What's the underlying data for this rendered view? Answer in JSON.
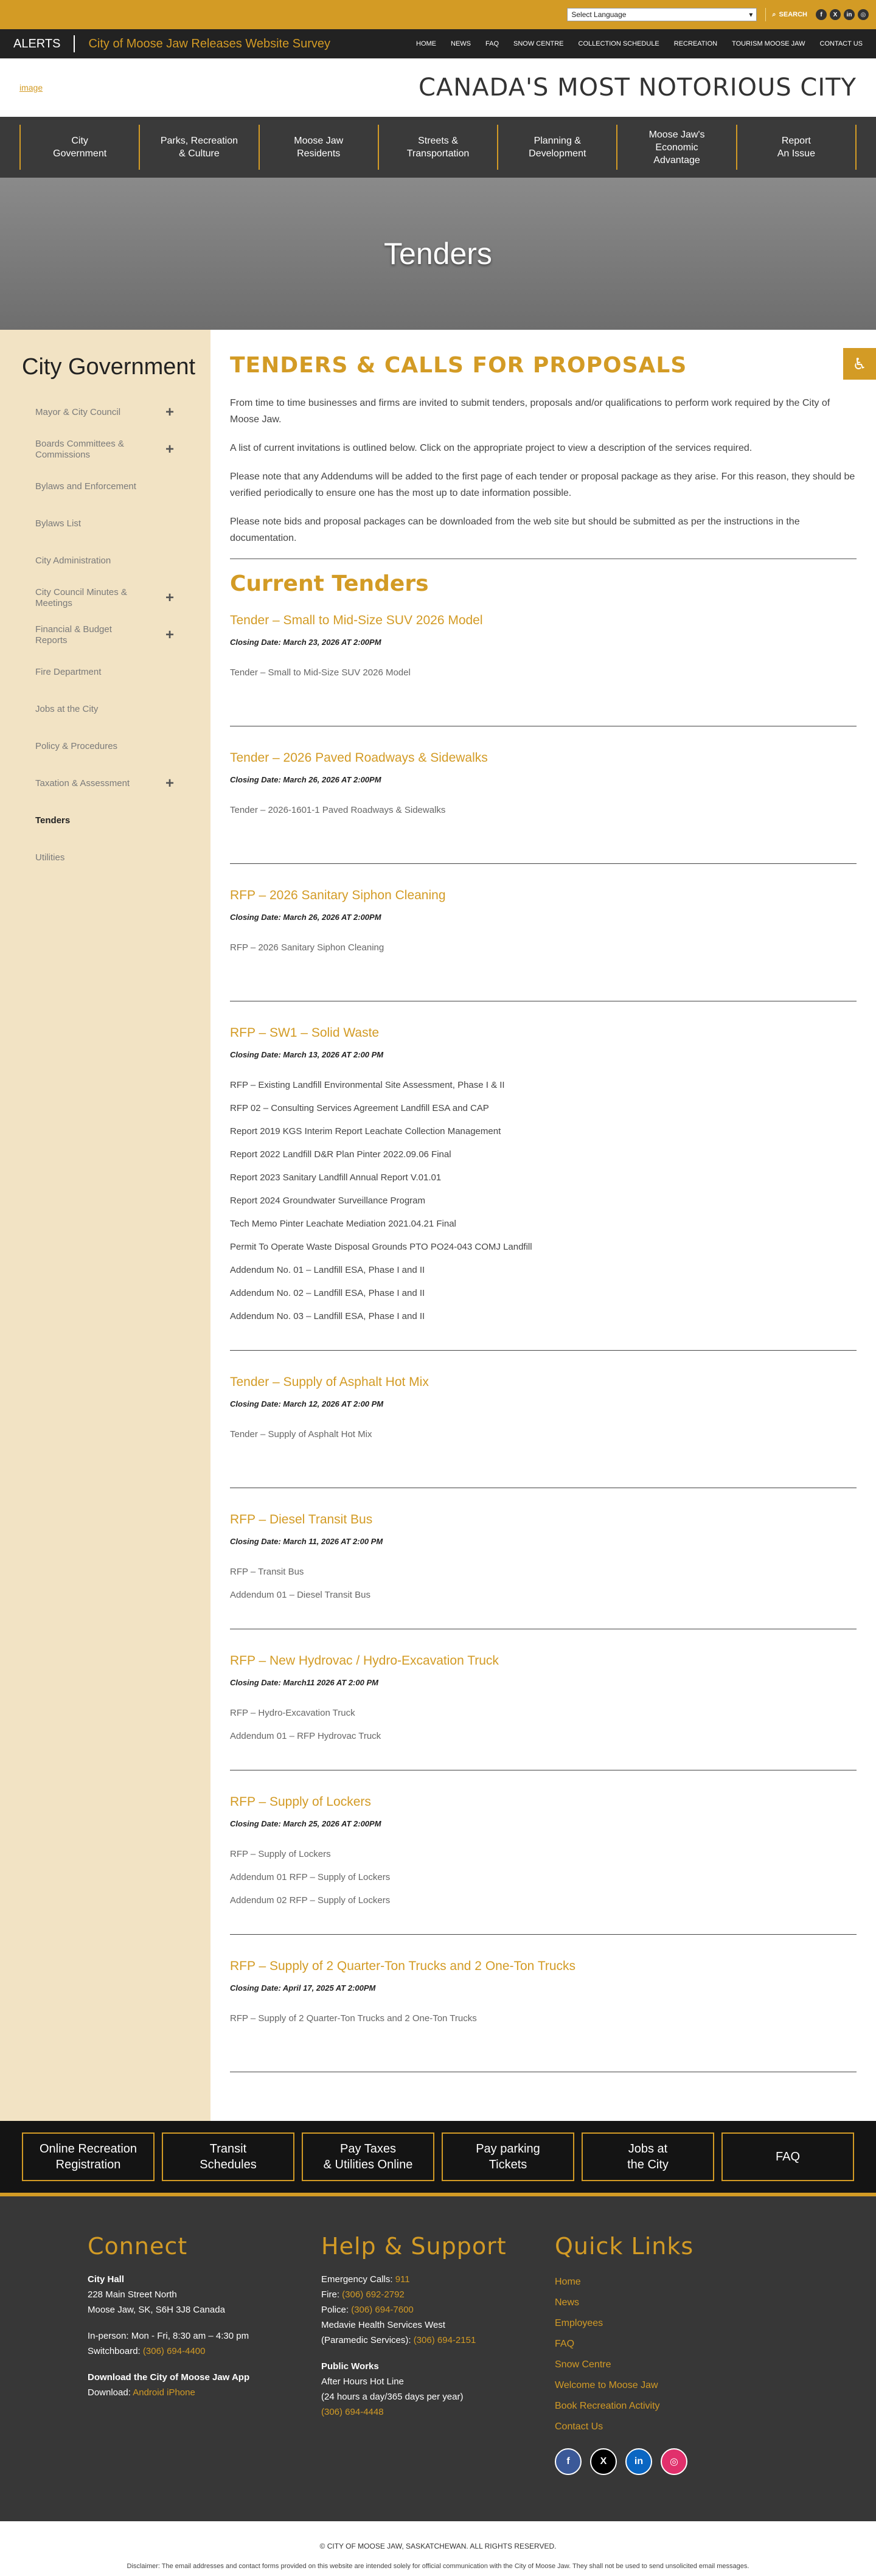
{
  "topbar": {
    "language_select": "Select Language",
    "search_label": "SEARCH",
    "social": [
      "facebook-icon",
      "x-icon",
      "linkedin-icon",
      "instagram-icon"
    ]
  },
  "alerts": {
    "label": "ALERTS",
    "message": "City of Moose Jaw Releases Website Survey"
  },
  "top_nav": [
    "HOME",
    "NEWS",
    "FAQ",
    "SNOW CENTRE",
    "COLLECTION SCHEDULE",
    "RECREATION",
    "TOURISM MOOSE JAW",
    "CONTACT US"
  ],
  "header": {
    "logo_alt": "image",
    "tagline": "CANADA'S MOST NOTORIOUS CITY"
  },
  "main_nav": [
    "City\nGovernment",
    "Parks, Recreation\n& Culture",
    "Moose Jaw\nResidents",
    "Streets &\nTransportation",
    "Planning &\nDevelopment",
    "Moose Jaw's\nEconomic\nAdvantage",
    "Report\nAn Issue"
  ],
  "banner": {
    "title": "Tenders"
  },
  "sidebar": {
    "title": "City Government",
    "items": [
      {
        "label": "Mayor & City Council",
        "expand": "+"
      },
      {
        "label": "Boards Committees & Commissions",
        "expand": "+"
      },
      {
        "label": "Bylaws and Enforcement",
        "expand": ""
      },
      {
        "label": "Bylaws List",
        "expand": ""
      },
      {
        "label": "City Administration",
        "expand": ""
      },
      {
        "label": "City Council Minutes & Meetings",
        "expand": "+"
      },
      {
        "label": "Financial & Budget Reports",
        "expand": "+"
      },
      {
        "label": "Fire Department",
        "expand": ""
      },
      {
        "label": "Jobs at the City",
        "expand": ""
      },
      {
        "label": "Policy & Procedures",
        "expand": ""
      },
      {
        "label": "Taxation & Assessment",
        "expand": "+"
      },
      {
        "label": "Tenders",
        "expand": ""
      },
      {
        "label": "Utilities",
        "expand": ""
      }
    ]
  },
  "main": {
    "heading": "TENDERS & CALLS FOR PROPOSALS",
    "intro": [
      "From time to time businesses and firms are invited to submit tenders, proposals and/or qualifications to perform work required by the City of Moose Jaw.",
      "A list of current invitations is outlined below. Click on the appropriate project to view a description of the services required.",
      "Please note that any Addendums will be added to the first page of each tender or proposal package as they arise. For this reason, they should be verified periodically to ensure one has the most up to date information possible.",
      "Please note bids and proposal packages can be downloaded from the web site but should be submitted as per the instructions in the documentation."
    ],
    "current_heading": "Current Tenders",
    "tenders": [
      {
        "title": "Tender – Small to Mid-Size SUV 2026 Model",
        "closing": "Closing Date: March 23, 2026 AT 2:00PM",
        "docs": [
          "Tender – Small to Mid-Size SUV 2026 Model"
        ]
      },
      {
        "title": "Tender – 2026 Paved Roadways & Sidewalks",
        "closing": "Closing Date: March 26, 2026 AT 2:00PM",
        "docs": [
          "Tender – 2026-1601-1 Paved Roadways & Sidewalks"
        ]
      },
      {
        "title": "RFP – 2026 Sanitary Siphon Cleaning",
        "closing": "Closing Date: March 26, 2026 AT 2:00PM",
        "docs": [
          "RFP – 2026 Sanitary Siphon Cleaning"
        ]
      },
      {
        "title": "RFP – SW1 – Solid Waste",
        "closing": "Closing Date: March 13, 2026 AT 2:00 PM",
        "docs": [
          "RFP – Existing Landfill Environmental Site Assessment, Phase I & II",
          "RFP 02 – Consulting Services Agreement Landfill ESA and CAP",
          "Report 2019 KGS Interim Report Leachate Collection Management",
          "Report 2022 Landfill D&R Plan Pinter 2022.09.06 Final",
          "Report 2023 Sanitary Landfill Annual Report V.01.01",
          "Report 2024 Groundwater Surveillance Program",
          "Tech Memo Pinter Leachate Mediation 2021.04.21 Final",
          "Permit To Operate Waste Disposal Grounds PTO PO24-043 COMJ Landfill",
          "Addendum No. 01 – Landfill ESA, Phase I and II",
          "Addendum No. 02 – Landfill ESA, Phase I and II",
          "Addendum No. 03 – Landfill ESA, Phase I and II"
        ]
      },
      {
        "title": "Tender – Supply of Asphalt Hot Mix",
        "closing": "Closing Date: March 12, 2026 AT 2:00 PM",
        "docs": [
          "Tender – Supply of Asphalt Hot Mix"
        ]
      },
      {
        "title": "RFP – Diesel Transit Bus",
        "closing": "Closing Date: March 11, 2026 AT 2:00 PM",
        "docs": [
          "RFP – Transit Bus",
          "Addendum 01 – Diesel Transit Bus"
        ]
      },
      {
        "title": "RFP – New Hydrovac / Hydro-Excavation Truck",
        "closing": "Closing Date: March11 2026 AT 2:00 PM",
        "docs": [
          "RFP – Hydro-Excavation Truck",
          "Addendum 01 – RFP Hydrovac Truck"
        ]
      },
      {
        "title": "RFP – Supply of Lockers",
        "closing": "Closing Date: March 25, 2026 AT 2:00PM",
        "docs": [
          "RFP – Supply of Lockers",
          "Addendum 01 RFP – Supply of Lockers",
          "Addendum 02 RFP – Supply of Lockers"
        ]
      },
      {
        "title": "RFP – Supply of 2 Quarter-Ton Trucks and 2 One-Ton Trucks",
        "closing": "Closing Date: April 17, 2025 AT 2:00PM",
        "docs": [
          "RFP – Supply of 2 Quarter-Ton Trucks and 2 One-Ton Trucks"
        ]
      }
    ]
  },
  "quick_buttons": [
    "Online Recreation\nRegistration",
    "Transit\nSchedules",
    "Pay Taxes\n& Utilities Online",
    "Pay parking\nTickets",
    "Jobs at\nthe City",
    "FAQ"
  ],
  "footer": {
    "connect": {
      "heading": "Connect",
      "name": "City Hall",
      "address1": "228 Main Street North",
      "address2": "Moose Jaw, SK, S6H 3J8 Canada",
      "hours": "In-person: Mon - Fri, 8:30 am – 4:30 pm",
      "switchboard_label": "Switchboard:",
      "switchboard": "(306) 694-4400",
      "app_heading": "Download the City of Moose Jaw App",
      "download_label": "Download:",
      "android": "Android",
      "iphone": "iPhone"
    },
    "help": {
      "heading": "Help & Support",
      "emergency_label": "Emergency Calls:",
      "emergency": "911",
      "fire_label": "Fire:",
      "fire": "(306) 692-2792",
      "police_label": "Police:",
      "police": "(306) 694-7600",
      "medavie": "Medavie Health Services West",
      "paramedic_label": "(Paramedic Services):",
      "paramedic": "(306) 694-2151",
      "works_heading": "Public Works",
      "after_hours": "After Hours Hot Line",
      "after_hours_note": "(24 hours a day/365 days per year)",
      "works_phone": "(306) 694-4448"
    },
    "quick_links": {
      "heading": "Quick Links",
      "links": [
        "Home",
        "News",
        "Employees",
        "FAQ",
        "Snow Centre",
        "Welcome to Moose Jaw",
        "Book Recreation Activity",
        "Contact Us"
      ]
    },
    "social": [
      "facebook-icon",
      "x-icon",
      "linkedin-icon",
      "instagram-icon"
    ]
  },
  "bottom": {
    "copyright": "© CITY OF MOOSE JAW, SASKATCHEWAN. ALL RIGHTS RESERVED.",
    "disclaimer": "Disclaimer: The email addresses and contact forms provided on this website are intended solely for official communication with the City of Moose Jaw. They shall not be used to send unsolicited email messages."
  }
}
